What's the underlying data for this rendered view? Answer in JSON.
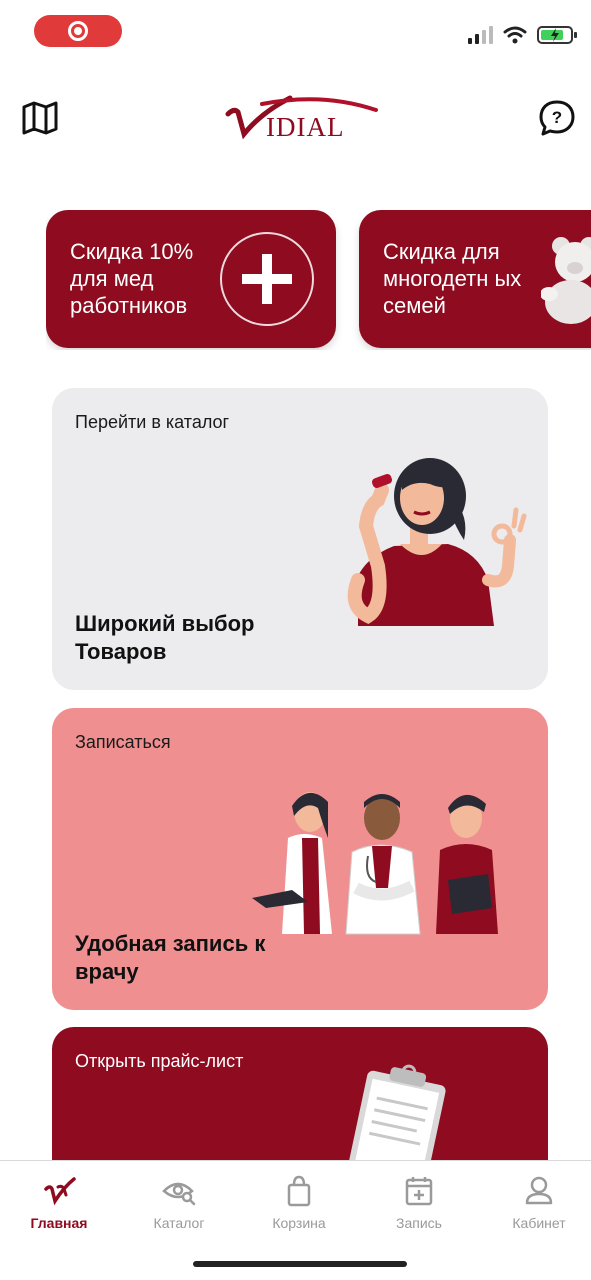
{
  "status_bar": {
    "record_indicator": "record-icon",
    "icons": [
      "cellular-signal-icon",
      "wifi-icon",
      "battery-charging-icon"
    ]
  },
  "header": {
    "logo_text": "IDIAL",
    "left_icon": "map-icon",
    "right_icon": "help-icon"
  },
  "promos": [
    {
      "text": "Скидка 10% для мед работников",
      "icon": "medical-cross-icon"
    },
    {
      "text": "Скидка для многодетн ых семей",
      "icon": "teddy-bear-icon"
    }
  ],
  "cards": {
    "catalog": {
      "label": "Перейти в каталог",
      "title": "Широкий выбор Товаров"
    },
    "booking": {
      "label": "Записаться",
      "title": "Удобная запись к врачу"
    },
    "price": {
      "label": "Открыть прайс-лист"
    }
  },
  "bottom_nav": [
    {
      "label": "Главная",
      "icon": "vidial-logo-icon",
      "active": true
    },
    {
      "label": "Каталог",
      "icon": "eye-search-icon",
      "active": false
    },
    {
      "label": "Корзина",
      "icon": "shopping-bag-icon",
      "active": false
    },
    {
      "label": "Запись",
      "icon": "calendar-plus-icon",
      "active": false
    },
    {
      "label": "Кабинет",
      "icon": "user-icon",
      "active": false
    }
  ],
  "colors": {
    "brand": "#8e0b20",
    "booking_card": "#f08f90",
    "catalog_card": "#ecebed",
    "nav_inactive": "#9a9a9a"
  }
}
